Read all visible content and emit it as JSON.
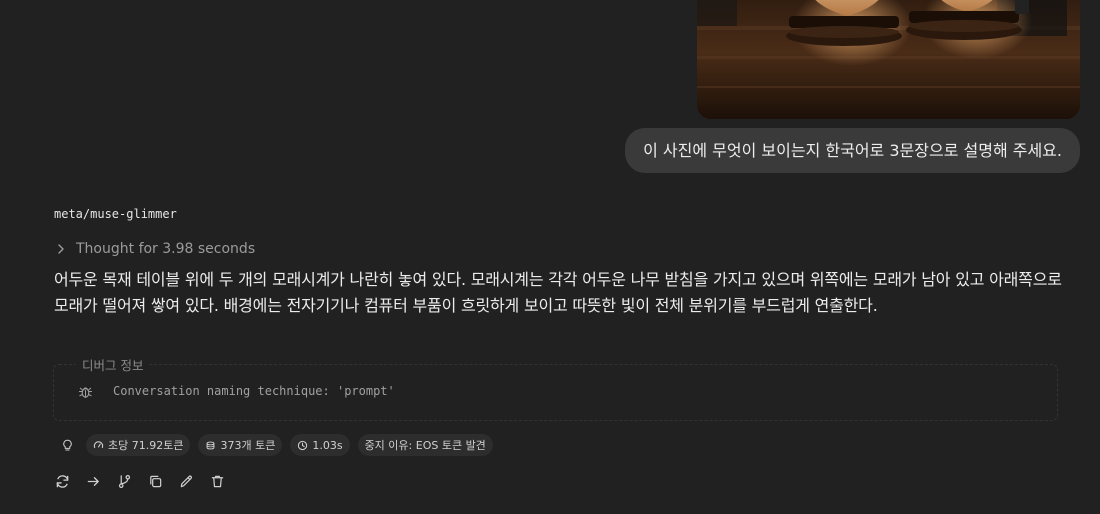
{
  "user_message": {
    "text": "이 사진에 무엇이 보이는지 한국어로 3문장으로 설명해 주세요."
  },
  "assistant": {
    "model": "meta/muse-glimmer",
    "thought_label": "Thought for 3.98 seconds",
    "answer": "어두운 목재 테이블 위에 두 개의 모래시계가 나란히 놓여 있다. 모래시계는 각각 어두운 나무 받침을 가지고 있으며 위쪽에는 모래가 남아 있고 아래쪽으로 모래가 떨어져 쌓여 있다. 배경에는 전자기기나 컴퓨터 부품이 흐릿하게 보이고 따뜻한 빛이 전체 분위기를 부드럽게 연출한다.",
    "debug": {
      "legend": "디버그 정보",
      "text": "Conversation naming technique: 'prompt'"
    },
    "stats": {
      "speed": "초당 71.92토큰",
      "tokens": "373개 토큰",
      "time": "1.03s",
      "stop_reason": "중지 이유: EOS 토큰 발견"
    },
    "actions": [
      "regenerate-icon",
      "continue-icon",
      "branch-icon",
      "copy-icon",
      "edit-icon",
      "delete-icon"
    ]
  },
  "colors": {
    "background": "#212121",
    "bubble": "#3a3a3a",
    "chip": "#2d2d2d",
    "text": "#ececec",
    "muted": "#9b9b9b"
  }
}
